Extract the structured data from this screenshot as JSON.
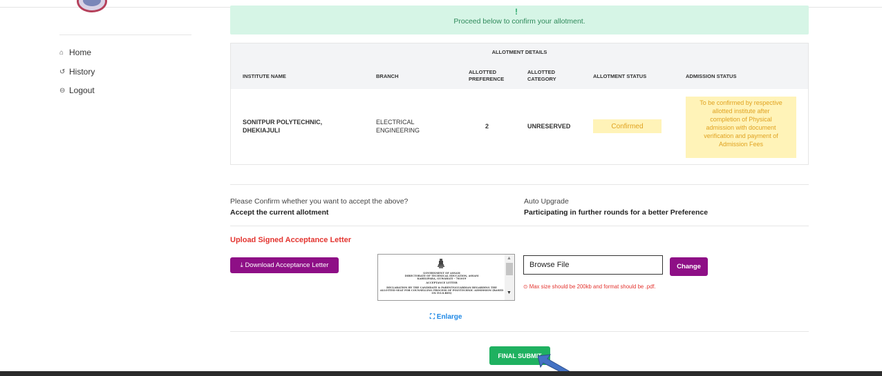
{
  "sidebar": {
    "items": [
      {
        "icon": "⌂",
        "label": "Home"
      },
      {
        "icon": "↺",
        "label": "History"
      },
      {
        "icon": "⊖",
        "label": "Logout"
      }
    ]
  },
  "banner": {
    "mark": "!",
    "message": "Proceed below to confirm your allotment."
  },
  "allotment": {
    "caption": "ALLOTMENT DETAILS",
    "headers": {
      "institute": "INSTITUTE NAME",
      "branch": "BRANCH",
      "preference_1": "ALLOTTED",
      "preference_2": "PREFERENCE",
      "category_1": "ALLOTTED",
      "category_2": "CATEGORY",
      "status": "ALLOTMENT STATUS",
      "admission": "ADMISSION STATUS"
    },
    "row": {
      "institute_1": "SONITPUR POLYTECHNIC,",
      "institute_2": "DHEKIAJULI",
      "branch_1": "ELECTRICAL",
      "branch_2": "ENGINEERING",
      "preference": "2",
      "category": "UNRESERVED",
      "status": "Confirmed",
      "admission_1": "To be confirmed by respective",
      "admission_2": "allotted institute after",
      "admission_3": "completion of Physical",
      "admission_4": "admission with document",
      "admission_5": "verification and payment of",
      "admission_6": "Admission Fees"
    }
  },
  "confirm": {
    "question": "Please Confirm whether you want to accept the above?",
    "accept_label": "Accept the current allotment",
    "upgrade_question": "Auto Upgrade",
    "upgrade_label": "Participating in further rounds for a better Preference"
  },
  "upload": {
    "title": "Upload Signed Acceptance Letter",
    "download_label": "⤓ Download Acceptance Letter",
    "file_value": "Browse File",
    "change_label": "Change",
    "hint": "⊙ Max size should be 200kb and format should be .pdf.",
    "enlarge_label": "⛶ Enlarge",
    "preview_lines": [
      "GOVERNMENT OF ASSAM",
      "DIRECTORATE OF TECHNICAL EDUCATION, ASSAM",
      "KAHILIPARA, GUWAHATI - 781019",
      "ACCEPTANCE LETTER",
      "DECLARATION BY THE CANDIDATE & PARENTS/GUARDIAN REGARDING THE",
      "ALLOTTED SEAT FOR COUNSELLING PROCESS OF POLYTECHNIC ADMISSION (BASED",
      "ON P.O.S.RES)"
    ]
  },
  "submit": {
    "label": "FINAL SUBMIT"
  },
  "colors": {
    "accent_purple": "#8e0f86",
    "submit_green": "#1fb160",
    "warning_yellow": "#fff3b8",
    "error_red": "#e3342f",
    "banner_green": "#d6f5e6",
    "arrow_blue": "#4472c4"
  }
}
